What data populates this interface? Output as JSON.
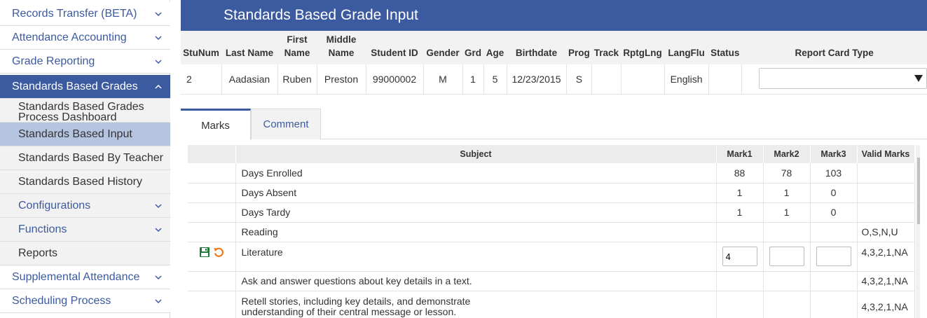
{
  "sidebar": {
    "items": [
      {
        "label": "Records Transfer (BETA)"
      },
      {
        "label": "Attendance Accounting"
      },
      {
        "label": "Grade Reporting"
      },
      {
        "label": "Standards Based Grades"
      },
      {
        "label": "Standards Based Grades Process Dashboard"
      },
      {
        "label": "Standards Based Input"
      },
      {
        "label": "Standards Based By Teacher"
      },
      {
        "label": "Standards Based History"
      },
      {
        "label": "Configurations"
      },
      {
        "label": "Functions"
      },
      {
        "label": "Reports"
      },
      {
        "label": "Supplemental Attendance"
      },
      {
        "label": "Scheduling Process"
      }
    ]
  },
  "header": {
    "title": "Standards Based Grade Input"
  },
  "student": {
    "columns": [
      "StuNum",
      "Last Name",
      "First Name",
      "Middle Name",
      "Student ID",
      "Gender",
      "Grd",
      "Age",
      "Birthdate",
      "Prog",
      "Track",
      "RptgLng",
      "LangFlu",
      "Status",
      "Report Card Type"
    ],
    "row": [
      "2",
      "Aadasian",
      "Ruben",
      "Preston",
      "99000002",
      "M",
      "1",
      "5",
      "12/23/2015",
      "S",
      "",
      "",
      "English",
      "",
      ""
    ]
  },
  "tabs": [
    {
      "label": "Marks"
    },
    {
      "label": "Comment"
    }
  ],
  "marks": {
    "headers": [
      "",
      "Subject",
      "Mark1",
      "Mark2",
      "Mark3",
      "Valid Marks"
    ],
    "rows": [
      {
        "subject": "Days Enrolled",
        "m1": "88",
        "m2": "78",
        "m3": "103",
        "valid": ""
      },
      {
        "subject": "Days Absent",
        "m1": "1",
        "m2": "1",
        "m3": "0",
        "valid": ""
      },
      {
        "subject": "Days Tardy",
        "m1": "1",
        "m2": "1",
        "m3": "0",
        "valid": ""
      },
      {
        "subject": "Reading",
        "m1": "",
        "m2": "",
        "m3": "",
        "valid": "O,S,N,U"
      },
      {
        "subject": "Literature",
        "m1": "4",
        "m2": "",
        "m3": "",
        "valid": "4,3,2,1,NA"
      },
      {
        "subject": "Ask and answer questions about key details in a text.",
        "m1": "",
        "m2": "",
        "m3": "",
        "valid": "4,3,2,1,NA"
      },
      {
        "subject": "Retell stories, including key details, and demonstrate understanding of their central message or lesson.",
        "m1": "",
        "m2": "",
        "m3": "",
        "valid": "4,3,2,1,NA"
      }
    ]
  },
  "colors": {
    "accent": "#3b5aa0",
    "save_icon": "#1f7a3a",
    "undo_icon": "#e87b1e"
  }
}
